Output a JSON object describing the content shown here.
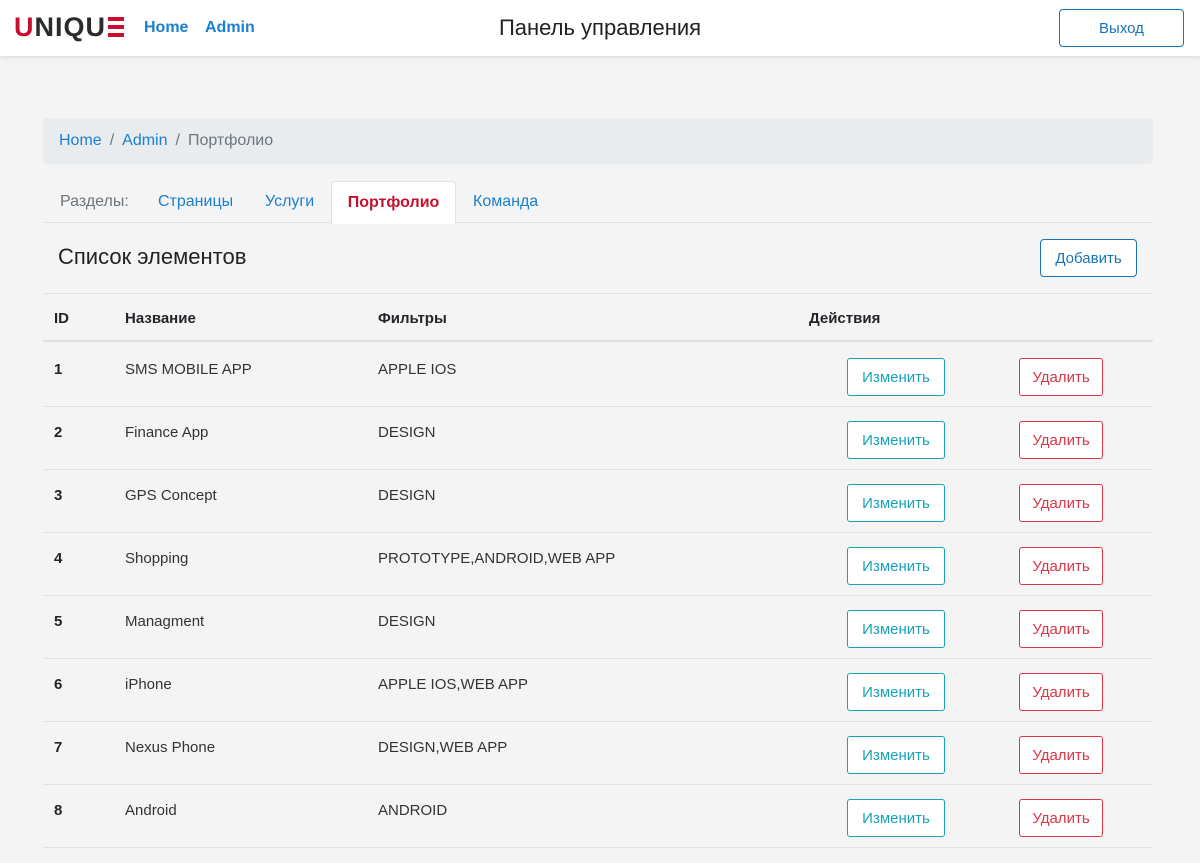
{
  "header": {
    "logo": "UNIQUE",
    "nav": [
      "Home",
      "Admin"
    ],
    "title": "Панель управления",
    "logout_label": "Выход",
    "colors": {
      "brand": "#c8102e",
      "link": "#1a7fd1"
    }
  },
  "breadcrumb": {
    "items": [
      "Home",
      "Admin"
    ],
    "current": "Портфолио"
  },
  "tabs": {
    "label": "Разделы:",
    "items": [
      "Страницы",
      "Услуги",
      "Портфолио",
      "Команда"
    ],
    "active": "Портфолио"
  },
  "list": {
    "title": "Список элементов",
    "add_label": "Добавить",
    "columns": [
      "ID",
      "Название",
      "Фильтры",
      "Действия"
    ],
    "edit_label": "Изменить",
    "delete_label": "Удалить",
    "rows": [
      {
        "id": "1",
        "name": "SMS MOBILE APP",
        "filters": "APPLE IOS"
      },
      {
        "id": "2",
        "name": "Finance App",
        "filters": "DESIGN"
      },
      {
        "id": "3",
        "name": "GPS Concept",
        "filters": "DESIGN"
      },
      {
        "id": "4",
        "name": "Shopping",
        "filters": "PROTOTYPE,ANDROID,WEB APP"
      },
      {
        "id": "5",
        "name": "Managment",
        "filters": "DESIGN"
      },
      {
        "id": "6",
        "name": "iPhone",
        "filters": "APPLE IOS,WEB APP"
      },
      {
        "id": "7",
        "name": "Nexus Phone",
        "filters": "DESIGN,WEB APP"
      },
      {
        "id": "8",
        "name": "Android",
        "filters": "ANDROID"
      }
    ]
  }
}
